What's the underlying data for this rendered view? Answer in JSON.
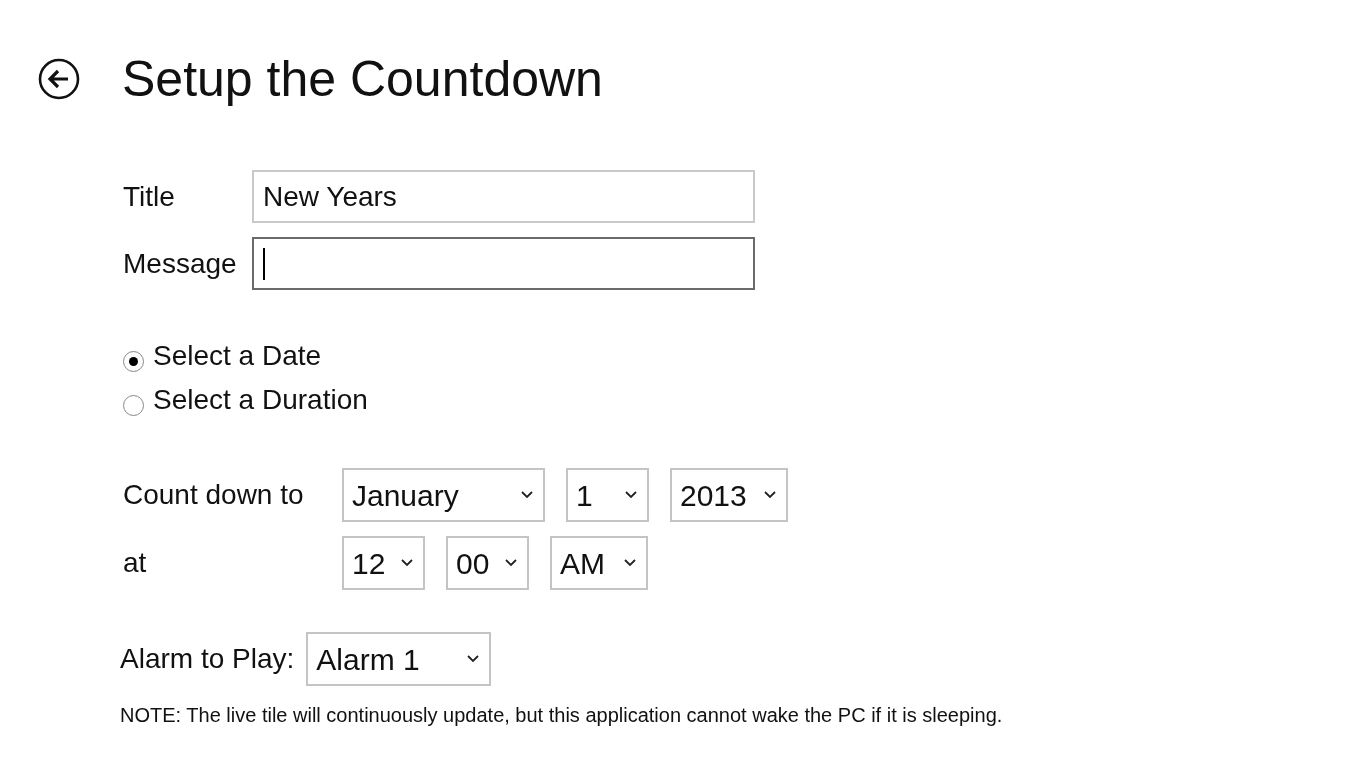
{
  "page": {
    "title": "Setup the Countdown"
  },
  "fields": [
    {
      "label": "Title",
      "value": "New Years",
      "focused": false
    },
    {
      "label": "Message",
      "focused": true
    }
  ],
  "mode_options": [
    {
      "label": "Select a Date",
      "selected": true
    },
    {
      "label": "Select a Duration",
      "selected": false
    }
  ],
  "countdown": {
    "label": "Count down to",
    "date": [
      "January",
      "1",
      "2013"
    ],
    "time_label": "at",
    "time": [
      "12",
      "00",
      "AM"
    ]
  },
  "alarm": {
    "label": "Alarm to Play:",
    "value": "Alarm 1"
  },
  "note": "NOTE: The live tile will continuously update, but this application cannot wake the PC if it is sleeping."
}
